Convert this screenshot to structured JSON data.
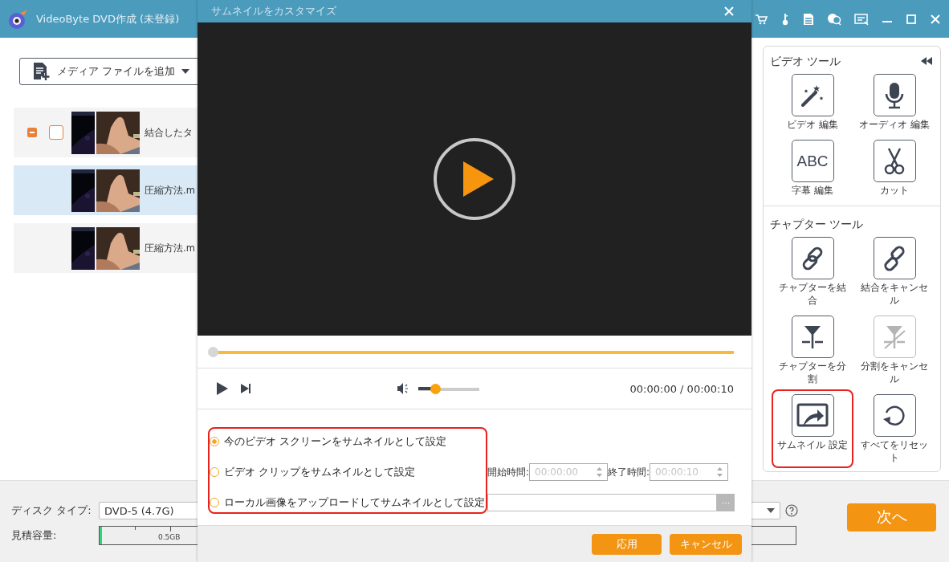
{
  "app": {
    "title": "VideoByte DVD作成 (未登録)"
  },
  "add_media_button": {
    "label": "メディア ファイルを追加"
  },
  "files": [
    {
      "name": "結合したタ",
      "kind": "group",
      "checked": false,
      "selected": false
    },
    {
      "name": "圧縮方法.m",
      "kind": "child",
      "selected": true
    },
    {
      "name": "圧縮方法.m",
      "kind": "child",
      "selected": false
    }
  ],
  "tool_panel": {
    "sections": [
      {
        "title": "ビデオ ツール",
        "tools": [
          {
            "label": "ビデオ 編集",
            "kind": "wand",
            "disabled": false,
            "highlighted": false
          },
          {
            "label": "オーディオ 編集",
            "kind": "mic",
            "disabled": false,
            "highlighted": false
          },
          {
            "label": "字幕 編集",
            "kind": "abc",
            "glyph": "ABC",
            "disabled": false,
            "highlighted": false
          },
          {
            "label": "カット",
            "kind": "scissors",
            "disabled": false,
            "highlighted": false
          }
        ]
      },
      {
        "title": "チャプター ツール",
        "tools": [
          {
            "label": "チャプターを結合",
            "kind": "link",
            "disabled": false,
            "highlighted": false
          },
          {
            "label": "結合をキャンセル",
            "kind": "unlink",
            "disabled": false,
            "highlighted": false
          },
          {
            "label": "チャプターを分割",
            "kind": "split",
            "disabled": false,
            "highlighted": false
          },
          {
            "label": "分割をキャンセル",
            "kind": "unsplit",
            "disabled": true,
            "highlighted": false
          },
          {
            "label": "サムネイル 設定",
            "kind": "thumbnail",
            "disabled": false,
            "highlighted": true
          },
          {
            "label": "すべてをリセット",
            "kind": "reset",
            "disabled": false,
            "highlighted": false
          }
        ]
      }
    ]
  },
  "disk": {
    "type_label": "ディスク タイプ:",
    "type_value": "DVD-5 (4.7G)",
    "capacity_label": "見積容量:",
    "capacity": {
      "level": 0.003
    },
    "tick_label": "0.5GB"
  },
  "next_button": "次へ",
  "dialog": {
    "title": "サムネイルをカスタマイズ",
    "progress": {
      "level": 0
    },
    "volume": {
      "level": 0.27
    },
    "time": "00:00:00 / 00:00:10",
    "options": [
      {
        "label": "今のビデオ スクリーンをサムネイルとして設定",
        "kind": "current",
        "selected": true
      },
      {
        "label": "ビデオ クリップをサムネイルとして設定",
        "kind": "clip",
        "selected": false
      },
      {
        "label": "ローカル画像をアップロードしてサムネイルとして設定",
        "kind": "upload",
        "selected": false
      }
    ],
    "start_label": "開始時間:",
    "start_value": "00:00:00",
    "end_label": "終了時間:",
    "end_value": "00:00:10",
    "fields_disabled": true,
    "browse": "···",
    "buttons": [
      "応用",
      "キャンセル"
    ]
  }
}
